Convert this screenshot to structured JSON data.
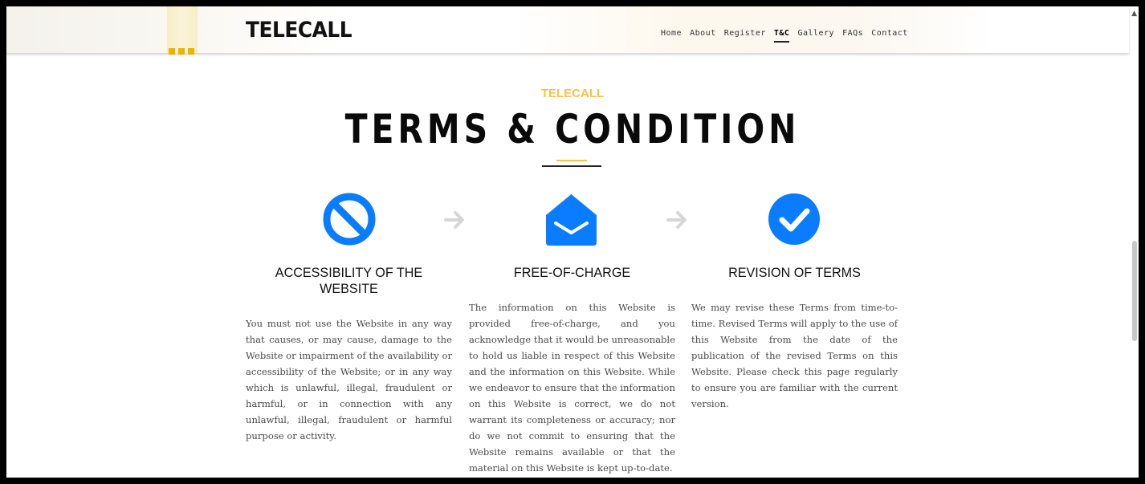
{
  "brand": {
    "logo": "TELECALL"
  },
  "nav": {
    "items": [
      "Home",
      "About",
      "Register",
      "T&C",
      "Gallery",
      "FAQs",
      "Contact"
    ],
    "active_index": 3
  },
  "header": {
    "eyebrow": "TELECALL",
    "title": "TERMS & CONDITION"
  },
  "columns": [
    {
      "icon": "ban-icon",
      "title": "ACCESSIBILITY OF THE WEBSITE",
      "text": "You must not use the Website in any way that causes, or may cause, damage to the Website or impairment of the availability or accessibility of the Website; or in any way which is unlawful, illegal, fraudulent or harmful, or in connection with any unlawful, illegal, fraudulent or harmful purpose or activity."
    },
    {
      "icon": "envelope-open-icon",
      "title": "FREE-OF-CHARGE",
      "text": "The information on this Website is provided free-of-charge, and you acknowledge that it would be unreasonable to hold us liable in respect of this Website and the information on this Website. While we endeavor to ensure that the information on this Website is correct, we do not warrant its completeness or accuracy; nor do we not commit to ensuring that the Website remains available or that the material on this Website is kept up-to-date."
    },
    {
      "icon": "check-circle-icon",
      "title": "REVISION OF TERMS",
      "text": "We may revise these Terms from time-to-time. Revised Terms will apply to the use of this Website from the date of the publication of the revised Terms on this Website. Please check this page regularly to ensure you are familiar with the current version."
    }
  ],
  "colors": {
    "accent_blue": "#0a7cff",
    "accent_gold": "#f6c24a",
    "arrow_gray": "#d6d6d6",
    "text": "#4a4a4a"
  }
}
